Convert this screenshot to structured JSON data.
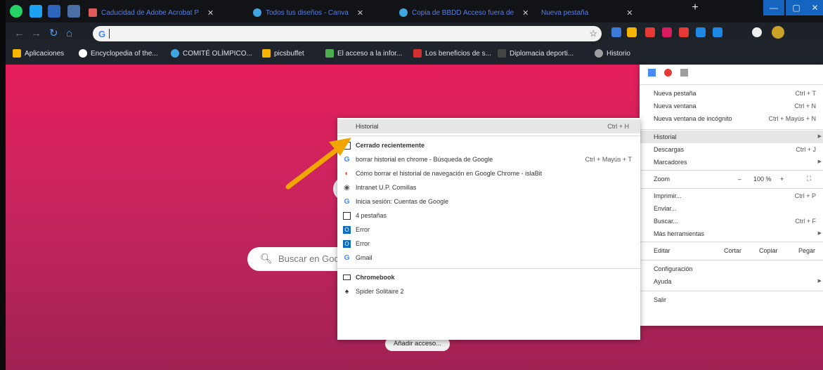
{
  "tabs": [
    {
      "label": "Caducidad de Adobe Acrobat P",
      "fav_color": "#e05a5a"
    },
    {
      "label": "Todos tus diseños - Canva",
      "fav_color": "#3fa6e0"
    },
    {
      "label": "Copia de BBDD Acceso fuera de",
      "fav_color": "#3fa6e0"
    },
    {
      "label": "Nueva pestaña",
      "fav_color": "#1d2128"
    }
  ],
  "window": {
    "new_tab": "+",
    "minimize": "—",
    "maximize": "▢",
    "close": "✕"
  },
  "omnibox": {
    "value": "",
    "star": "☆"
  },
  "bookmarks": [
    {
      "label": "Aplicaciones",
      "color": "#f4b400"
    },
    {
      "label": "Encyclopedia of the...",
      "color": "#ffffff"
    },
    {
      "label": "COMITÉ OLÍMPICO...",
      "color": "#3fa6e0"
    },
    {
      "label": "picsbuffet",
      "color": "#f4b400"
    },
    {
      "label": "El acceso a la infor...",
      "color": "#4caf50"
    },
    {
      "label": "Los beneficios de s...",
      "color": "#d32f2f"
    },
    {
      "label": "Diplomacia deporti...",
      "color": "#444444"
    },
    {
      "label": "Historio",
      "color": "#9e9e9e"
    }
  ],
  "page": {
    "search_placeholder": "Buscar en Goc",
    "add_shortcut_label": "Añadir acceso...",
    "add_symbol": "+"
  },
  "main_menu": {
    "items_top": [
      {
        "label": "Nueva pestaña",
        "shortcut": "Ctrl + T"
      },
      {
        "label": "Nueva ventana",
        "shortcut": "Ctrl + N"
      },
      {
        "label": "Nueva ventana de incógnito",
        "shortcut": "Ctrl + Mayús + N"
      }
    ],
    "historial": "Historial",
    "downloads": {
      "label": "Descargas",
      "shortcut": "Ctrl + J"
    },
    "bookmarks": "Marcadores",
    "zoom": {
      "label": "Zoom",
      "minus": "–",
      "value": "100 %",
      "plus": "+",
      "full": "⛶"
    },
    "print": {
      "label": "Imprimir...",
      "shortcut": "Ctrl + P"
    },
    "send": "Enviar...",
    "find": {
      "label": "Buscar...",
      "shortcut": "Ctrl + F"
    },
    "more_tools": "Más herramientas",
    "edit": {
      "label": "Editar",
      "cut": "Cortar",
      "copy": "Copiar",
      "paste": "Pegar"
    },
    "settings": "Configuración",
    "help": "Ayuda",
    "exit": "Salir"
  },
  "history_menu": {
    "header": {
      "label": "Historial",
      "shortcut": "Ctrl + H"
    },
    "recent_title": "Cerrado recientemente",
    "recent_items": [
      {
        "label": "borrar historial en chrome - Búsqueda de Google",
        "shortcut": "Ctrl + Mayús + T",
        "icon": "G",
        "color": "#4285f4"
      },
      {
        "label": "Cómo borrar el historial de navegación en Google Chrome - islaBit",
        "shortcut": "",
        "icon": "◐",
        "color": "#e8453c"
      },
      {
        "label": "Intranet U.P. Comillas",
        "shortcut": "",
        "icon": "◉",
        "color": "#555555"
      },
      {
        "label": "Inicia sesión: Cuentas de Google",
        "shortcut": "",
        "icon": "G",
        "color": "#4285f4"
      },
      {
        "label": "4 pestañas",
        "shortcut": "",
        "icon": "▢",
        "color": "#333333"
      },
      {
        "label": "Error",
        "shortcut": "",
        "icon": "O",
        "color": "#0f6cbd"
      },
      {
        "label": "Error",
        "shortcut": "",
        "icon": "O",
        "color": "#0f6cbd"
      },
      {
        "label": "Gmail",
        "shortcut": "",
        "icon": "G",
        "color": "#4285f4"
      }
    ],
    "device_title": "Chromebook",
    "device_items": [
      {
        "label": "Spider Solitaire 2",
        "icon": "♠",
        "color": "#333333"
      }
    ]
  },
  "colors": {
    "accent": "#f0a500",
    "page_top": "#e61f5c",
    "menu_highlight": "#e6e6e6"
  }
}
